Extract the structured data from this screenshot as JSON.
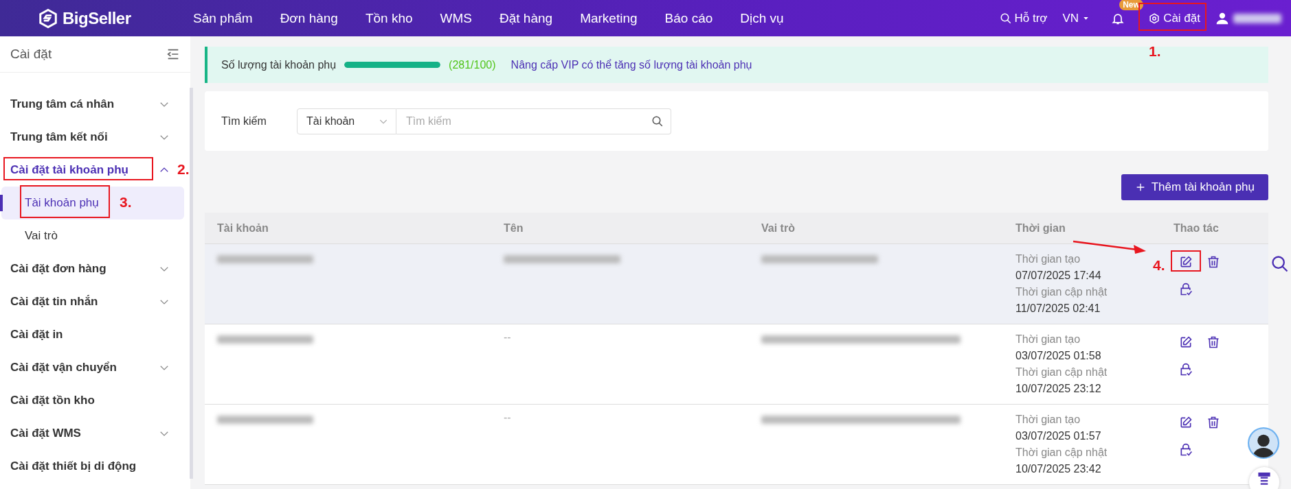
{
  "nav": {
    "brand": "BigSeller",
    "menu": [
      "Sản phẩm",
      "Đơn hàng",
      "Tồn kho",
      "WMS",
      "Đặt hàng",
      "Marketing",
      "Báo cáo",
      "Dịch vụ"
    ],
    "support": "Hỗ trợ",
    "language": "VN",
    "new_badge": "New",
    "settings": "Cài đặt"
  },
  "sidebar": {
    "title": "Cài đặt",
    "items": [
      {
        "kind": "collapsible",
        "label": "Trung tâm cá nhân",
        "expanded": false,
        "selected": false
      },
      {
        "kind": "collapsible",
        "label": "Trung tâm kết nối",
        "expanded": false,
        "selected": false
      },
      {
        "kind": "collapsible",
        "label": "Cài đặt tài khoản phụ",
        "expanded": true,
        "selected": true,
        "children": [
          {
            "label": "Tài khoản phụ",
            "selected": true
          },
          {
            "label": "Vai trò",
            "selected": false
          }
        ]
      },
      {
        "kind": "collapsible",
        "label": "Cài đặt đơn hàng",
        "expanded": false,
        "selected": false
      },
      {
        "kind": "collapsible",
        "label": "Cài đặt tin nhắn",
        "expanded": false,
        "selected": false
      },
      {
        "kind": "link",
        "label": "Cài đặt in",
        "selected": false
      },
      {
        "kind": "collapsible",
        "label": "Cài đặt vận chuyển",
        "expanded": false,
        "selected": false
      },
      {
        "kind": "link",
        "label": "Cài đặt tồn kho",
        "selected": false
      },
      {
        "kind": "collapsible",
        "label": "Cài đặt WMS",
        "expanded": false,
        "selected": false
      },
      {
        "kind": "link",
        "label": "Cài đặt thiết bị di động",
        "selected": false
      }
    ]
  },
  "banner": {
    "label": "Số lượng tài khoản phụ",
    "level": 1,
    "count": "(281/100)",
    "upgrade_link": "Nâng cấp VIP có thể tăng số lượng tài khoản phụ"
  },
  "search": {
    "label": "Tìm kiếm",
    "field": "Tài khoản",
    "placeholder": "Tìm kiếm"
  },
  "add_button": "Thêm tài khoản phụ",
  "table": {
    "columns": [
      "Tài khoản",
      "Tên",
      "Vai trò",
      "Thời gian",
      "Thao tác"
    ],
    "rows": [
      {
        "highlighted": true,
        "created_label": "Thời gian tạo",
        "created": "07/07/2025 17:44",
        "updated_label": "Thời gian cập nhật",
        "updated": "11/07/2025 02:41"
      },
      {
        "highlighted": false,
        "name": "--",
        "created_label": "Thời gian tạo",
        "created": "03/07/2025 01:58",
        "updated_label": "Thời gian cập nhật",
        "updated": "10/07/2025 23:12"
      },
      {
        "highlighted": false,
        "name": "--",
        "created_label": "Thời gian tạo",
        "created": "03/07/2025 01:57",
        "updated_label": "Thời gian cập nhật",
        "updated": "10/07/2025 23:42"
      }
    ]
  },
  "annotations": [
    "1.",
    "2.",
    "3.",
    "4."
  ]
}
